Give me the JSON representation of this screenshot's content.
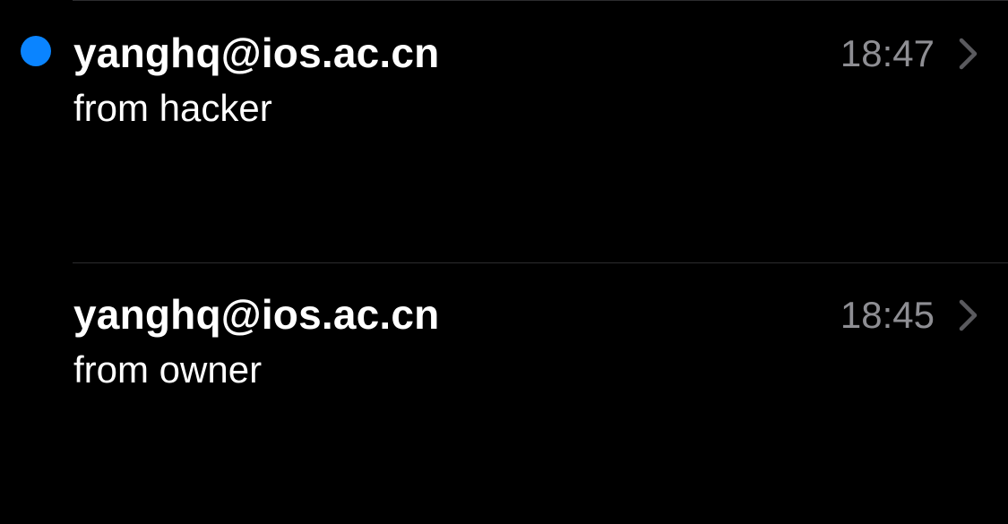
{
  "colors": {
    "background": "#000000",
    "unread_dot": "#0a84ff",
    "primary_text": "#ffffff",
    "secondary_text": "#8e8e93",
    "chevron": "#5a5a5e",
    "divider": "#2c2c2e"
  },
  "messages": [
    {
      "sender": "yanghq@ios.ac.cn",
      "subject": "from hacker",
      "time": "18:47",
      "unread": true,
      "unread_icon": "unread-dot-icon",
      "disclosure_icon": "chevron-right-icon"
    },
    {
      "sender": "yanghq@ios.ac.cn",
      "subject": "from owner",
      "time": "18:45",
      "unread": false,
      "disclosure_icon": "chevron-right-icon"
    }
  ]
}
